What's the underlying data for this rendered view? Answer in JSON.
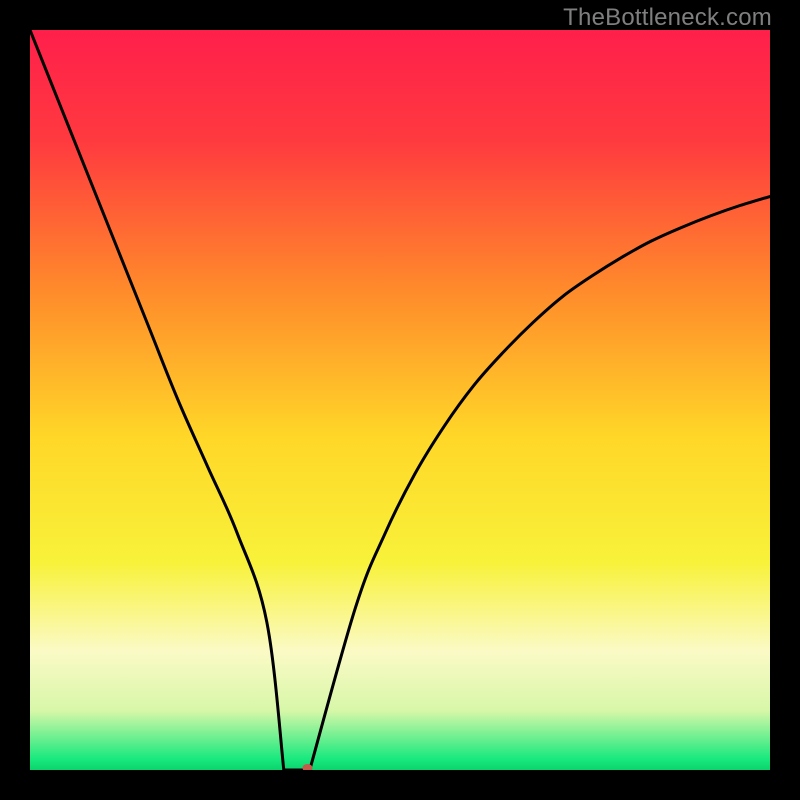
{
  "watermark": "TheBottleneck.com",
  "chart_data": {
    "type": "line",
    "title": "",
    "xlabel": "",
    "ylabel": "",
    "xlim": [
      0,
      100
    ],
    "ylim": [
      0,
      100
    ],
    "gradient_stops": [
      {
        "offset": 0.0,
        "color": "#ff1f4b"
      },
      {
        "offset": 0.15,
        "color": "#ff3a3f"
      },
      {
        "offset": 0.35,
        "color": "#ff8a2b"
      },
      {
        "offset": 0.55,
        "color": "#ffd728"
      },
      {
        "offset": 0.72,
        "color": "#f8f23a"
      },
      {
        "offset": 0.84,
        "color": "#fbfac6"
      },
      {
        "offset": 0.92,
        "color": "#d7f7a8"
      },
      {
        "offset": 0.985,
        "color": "#19e97e"
      },
      {
        "offset": 1.0,
        "color": "#0bd36d"
      }
    ],
    "series": [
      {
        "name": "bottleneck-curve",
        "x": [
          0,
          4,
          8,
          12,
          16,
          20,
          24,
          28,
          32,
          34,
          36,
          37,
          40,
          44,
          48,
          52,
          56,
          60,
          64,
          68,
          72,
          76,
          80,
          84,
          88,
          92,
          96,
          100
        ],
        "y": [
          100,
          90,
          80,
          70,
          60,
          50,
          41,
          32,
          20,
          10,
          0,
          0,
          10,
          22,
          32,
          40,
          46.5,
          52,
          56.5,
          60.5,
          64,
          66.8,
          69.3,
          71.5,
          73.3,
          74.9,
          76.3,
          77.5
        ]
      }
    ],
    "marker": {
      "x": 37.5,
      "y": 0,
      "rx": 5,
      "ry": 4,
      "color": "#c45a4a"
    },
    "valley_flat": {
      "x0": 34.3,
      "x1": 37.8
    }
  }
}
